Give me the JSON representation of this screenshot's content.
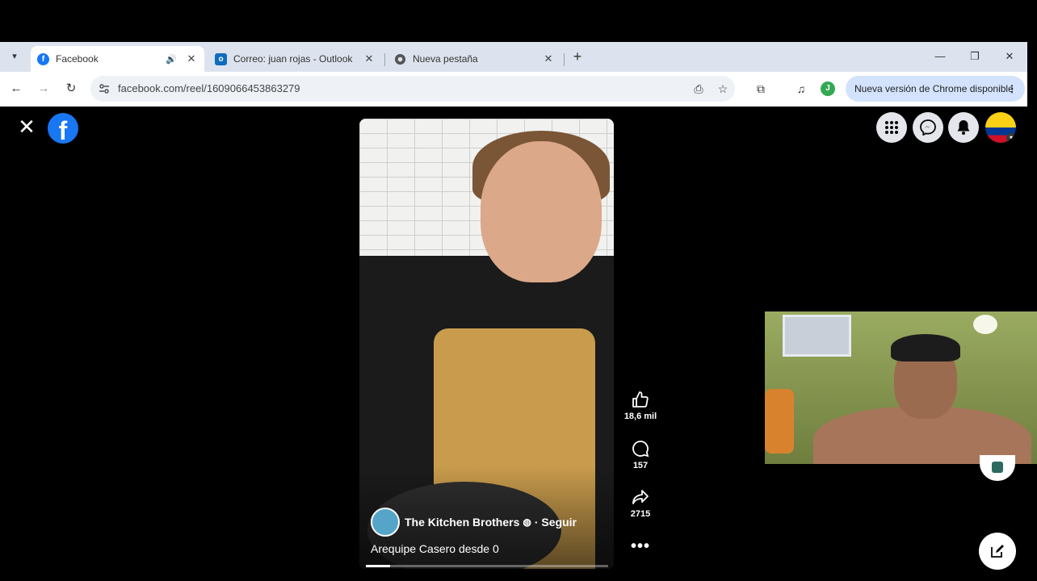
{
  "browser": {
    "tabs": [
      {
        "title": "Facebook",
        "favicon": "facebook-icon",
        "active": true,
        "audio": true
      },
      {
        "title": "Correo: juan rojas - Outlook",
        "favicon": "outlook-icon",
        "active": false
      },
      {
        "title": "Nueva pestaña",
        "favicon": "chrome-icon",
        "active": false
      }
    ],
    "close_glyph": "✕",
    "url": "facebook.com/reel/1609066453863279",
    "profile_initial": "J",
    "update_label": "Nueva versión de Chrome disponible"
  },
  "reel": {
    "author": "The Kitchen Brothers",
    "follow_label": "· Seguir",
    "caption": "Arequipe Casero desde 0",
    "likes": "18,6 mil",
    "comments": "157",
    "shares": "2715",
    "progress": 0.1
  },
  "colors": {
    "facebook_blue": "#1877f2",
    "chrome_frame": "#dde3ee",
    "update_pill": "#d3e3fd"
  }
}
